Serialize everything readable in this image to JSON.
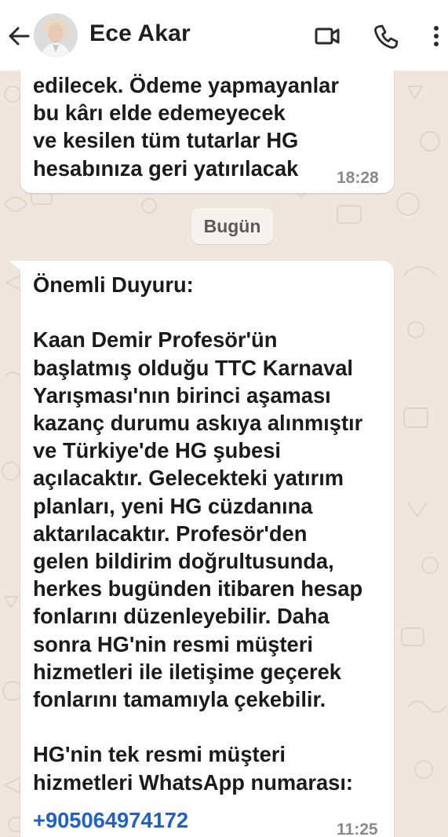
{
  "header": {
    "back_label": "Back",
    "contact_name": "Ece Akar",
    "icons": [
      "arrow-left-icon",
      "avatar",
      "video-call-icon",
      "phone-icon",
      "more-vertical-icon"
    ]
  },
  "colors": {
    "header_bg": "#ffffff",
    "chat_bg": "#efe7de",
    "bubble_bg": "#ffffff",
    "link": "#1e62c8",
    "timestamp": "#8a8a8a"
  },
  "messages": [
    {
      "text": "edilecek. Ödeme yapmayanlar\nbu kârı elde edemeyecek\nve kesilen tüm tutarlar HG\nhesabınıza geri yatırılacak",
      "time": "18:28"
    },
    {
      "text": "Önemli Duyuru:\n\nKaan Demir Profesör'ün\nbaşlatmış olduğu TTC Karnaval\nYarışması'nın birinci aşaması\nkazanç durumu askıya alınmıştır\nve Türkiye'de HG şubesi\naçılacaktır. Gelecekteki yatırım\nplanları, yeni HG cüzdanına\naktarılacaktır. Profesör'den\ngelen bildirim doğrultusunda,\nherkes bugünden itibaren hesap\nfonlarını düzenleyebilir. Daha\nsonra HG'nin resmi müşteri\nhizmetleri ile iletişime geçerek\nfonlarını tamamıyla çekebilir.\n\nHG'nin tek resmi müşteri\nhizmetleri WhatsApp numarası:",
      "link": "+905064974172",
      "time": "11:25"
    }
  ],
  "date_divider": "Bugün"
}
